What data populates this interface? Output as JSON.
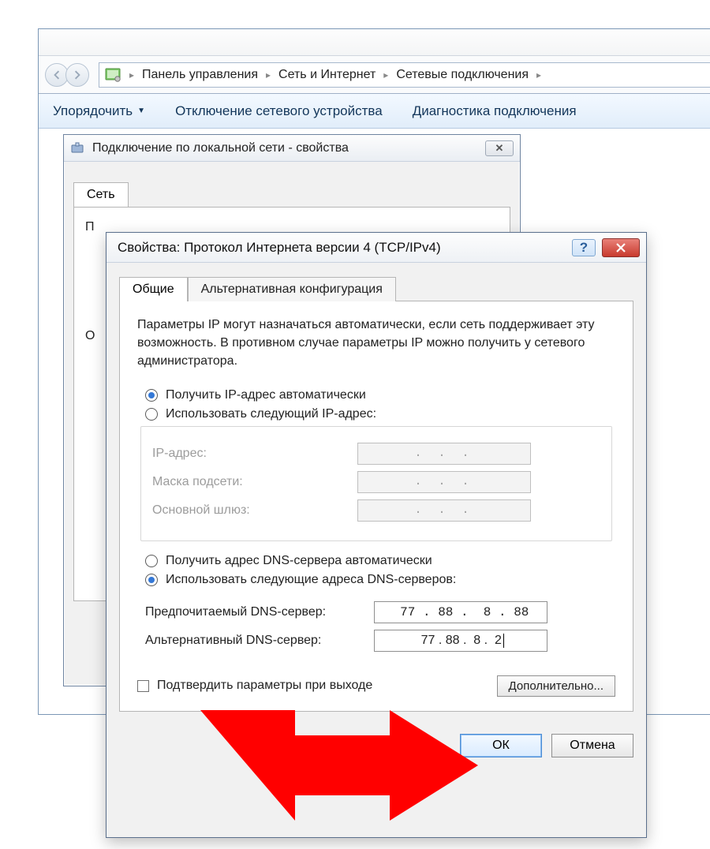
{
  "explorer": {
    "breadcrumb": [
      "Панель управления",
      "Сеть и Интернет",
      "Сетевые подключения"
    ],
    "toolbar": {
      "organize": "Упорядочить",
      "disable": "Отключение сетевого устройства",
      "diagnose": "Диагностика подключения"
    }
  },
  "props_dialog": {
    "title": "Подключение по локальной сети - свойства",
    "tab_network": "Сеть",
    "label_connect_with_initial": "П",
    "label_used_components_initial": "О"
  },
  "ipv4": {
    "title": "Свойства: Протокол Интернета версии 4 (TCP/IPv4)",
    "tab_general": "Общие",
    "tab_alt": "Альтернативная конфигурация",
    "desc": "Параметры IP могут назначаться автоматически, если сеть поддерживает эту возможность. В противном случае параметры IP можно получить у сетевого администратора.",
    "ip_auto": "Получить IP-адрес автоматически",
    "ip_manual": "Использовать следующий IP-адрес:",
    "ip_fields": {
      "ip": "IP-адрес:",
      "mask": "Маска подсети:",
      "gateway": "Основной шлюз:"
    },
    "dns_auto": "Получить адрес DNS-сервера автоматически",
    "dns_manual": "Использовать следующие адреса DNS-серверов:",
    "dns_fields": {
      "preferred_label": "Предпочитаемый DNS-сервер:",
      "alternate_label": "Альтернативный DNS-сервер:",
      "preferred_value": " 77 . 88 .  8 . 88",
      "alternate_value": " 77 . 88 .  8 .  2"
    },
    "validate": "Подтвердить параметры при выходе",
    "advanced": "Дополнительно...",
    "ok": "ОК",
    "cancel": "Отмена",
    "empty_dots": ".   .   ."
  }
}
